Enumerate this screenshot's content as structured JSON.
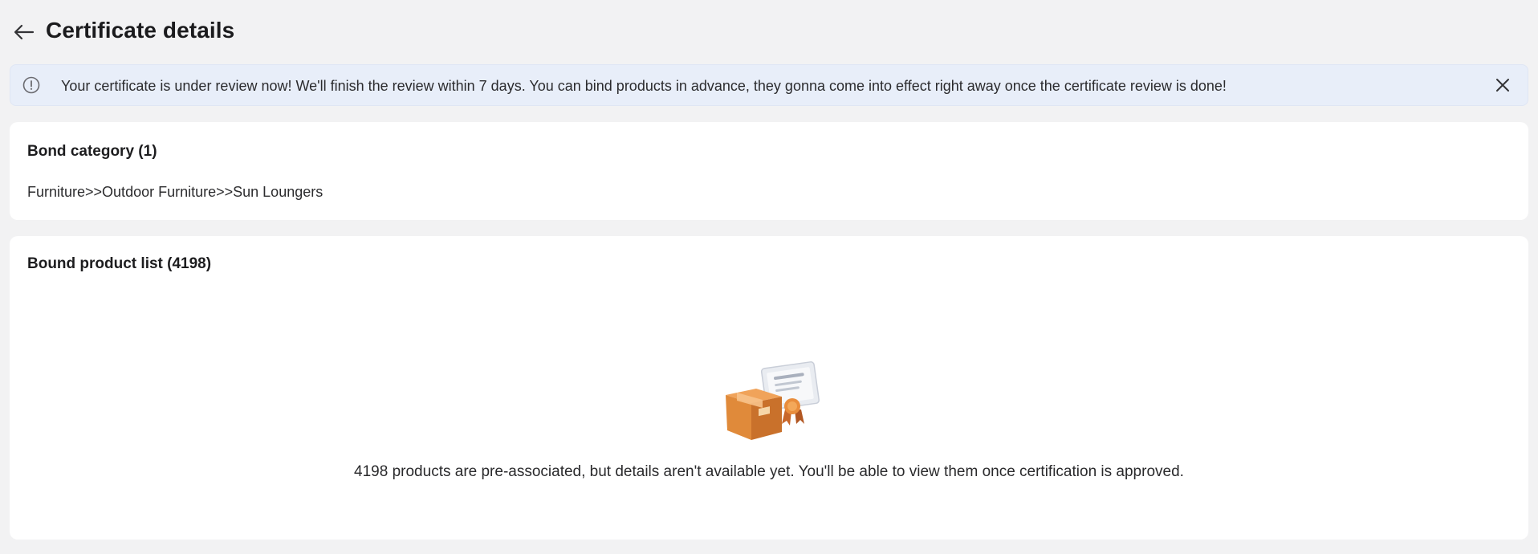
{
  "header": {
    "title": "Certificate details",
    "back_icon": "arrow-left-icon"
  },
  "alert": {
    "icon": "info-circle-icon",
    "message": "Your certificate is under review now! We'll finish the review within 7 days. You can bind products in advance, they gonna come into effect right away once the certificate review is done!",
    "close_icon": "close-icon",
    "background_color": "#e8eef9"
  },
  "bond_category": {
    "title": "Bond category (1)",
    "path": "Furniture>>Outdoor Furniture>>Sun Loungers"
  },
  "bound_products": {
    "title": "Bound product list (4198)",
    "illustration_icon": "box-certificate-icon",
    "empty_message": "4198 products are pre-associated, but details aren't available yet. You'll be able to view them once certification is approved."
  },
  "colors": {
    "page_background": "#f2f2f3",
    "card_background": "#ffffff",
    "box_orange": "#e08a3a"
  }
}
